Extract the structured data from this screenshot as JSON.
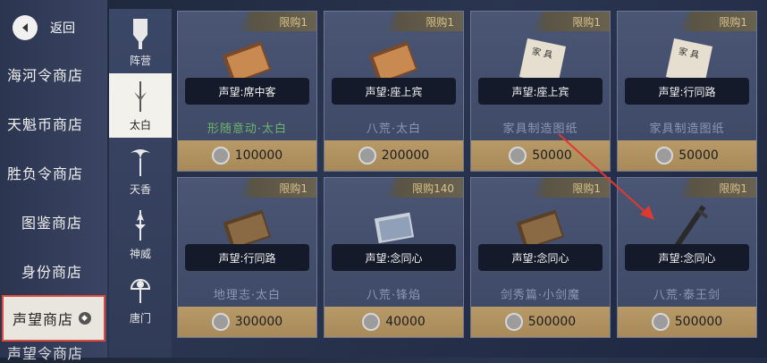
{
  "back": {
    "label": "返回"
  },
  "shops": [
    {
      "label": "海河令商店"
    },
    {
      "label": "天魁币商店"
    },
    {
      "label": "胜负令商店"
    },
    {
      "label": "图鉴商店"
    },
    {
      "label": "身份商店"
    },
    {
      "label": "声望商店"
    },
    {
      "label": "声望令商店"
    }
  ],
  "factions": [
    {
      "label": "阵营"
    },
    {
      "label": "太白"
    },
    {
      "label": "天香"
    },
    {
      "label": "神威"
    },
    {
      "label": "唐门"
    }
  ],
  "items": [
    {
      "limit": "限购1",
      "rep": "声望:席中客",
      "name": "形随意动·太白",
      "price": "100000",
      "name_color": "green"
    },
    {
      "limit": "限购1",
      "rep": "声望:座上宾",
      "name": "八荒·太白",
      "price": "200000",
      "name_color": "default"
    },
    {
      "limit": "限购1",
      "rep": "声望:座上宾",
      "name": "家具制造图纸",
      "price": "50000",
      "name_color": "default"
    },
    {
      "limit": "限购1",
      "rep": "声望:行同路",
      "name": "家具制造图纸",
      "price": "50000",
      "name_color": "default"
    },
    {
      "limit": "限购1",
      "rep": "声望:行同路",
      "name": "地理志·太白",
      "price": "300000",
      "name_color": "default"
    },
    {
      "limit": "限购140",
      "rep": "声望:念同心",
      "name": "八荒·锋焰",
      "price": "40000",
      "name_color": "default"
    },
    {
      "limit": "限购1",
      "rep": "声望:念同心",
      "name": "剑秀篇·小剑魔",
      "price": "500000",
      "name_color": "default"
    },
    {
      "limit": "限购1",
      "rep": "声望:念同心",
      "name": "八荒·泰王剑",
      "price": "500000",
      "name_color": "default"
    }
  ],
  "colors": {
    "highlight": "#e04a3e",
    "price_bar": "#b89a68",
    "limit_text": "#d9c38a"
  }
}
